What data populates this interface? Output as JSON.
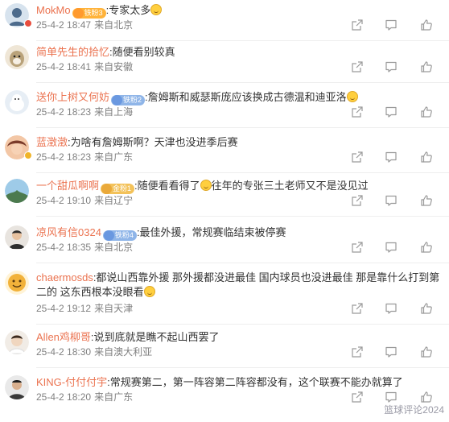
{
  "comments": [
    {
      "id": "c1",
      "username": "MokMo",
      "badge": "铁粉3",
      "badge_style": "orange",
      "text": ":专家太多",
      "emoji_after": true,
      "emoji_mid": false,
      "text2": "",
      "date": "25-4-2 18:47",
      "source": "来自北京",
      "avatar_color": "#4d6b8c",
      "vbadge": "#e84d3d"
    },
    {
      "id": "c2",
      "username": "简单先生的拾忆",
      "badge": "",
      "badge_style": "orange",
      "text": ":随便看别较真",
      "emoji_after": false,
      "emoji_mid": false,
      "text2": "",
      "date": "25-4-2 18:41",
      "source": "来自安徽",
      "avatar_color": "#b9a27a",
      "vbadge": ""
    },
    {
      "id": "c3",
      "username": "送你上树又何妨",
      "badge": "铁粉2",
      "badge_style": "blue",
      "text": ":詹姆斯和威瑟斯庞应该换成古德温和迪亚洛",
      "emoji_after": true,
      "emoji_mid": false,
      "text2": "",
      "date": "25-4-2 18:23",
      "source": "来自上海",
      "avatar_color": "#cfd8e0",
      "vbadge": ""
    },
    {
      "id": "c4",
      "username": "蓝澂澂",
      "badge": "",
      "badge_style": "orange",
      "text": ":为啥有詹姆斯啊？天津也没进季后赛",
      "emoji_after": false,
      "emoji_mid": false,
      "text2": "",
      "date": "25-4-2 18:23",
      "source": "来自广东",
      "avatar_color": "#7a3b2a",
      "vbadge": "#f0b429"
    },
    {
      "id": "c5",
      "username": "一个甜瓜啊啊",
      "badge": "金粉1",
      "badge_style": "gold",
      "text": ":随便看看得了",
      "emoji_after": false,
      "emoji_mid": true,
      "text2": "往年的专张三土老师又不是没见过",
      "date": "25-4-2 19:10",
      "source": "来自辽宁",
      "avatar_color": "#4c7a4e",
      "vbadge": ""
    },
    {
      "id": "c6",
      "username": "凉风有信0324",
      "badge": "铁粉4",
      "badge_style": "blue",
      "text": ":最佳外援，常规赛临结束被停赛",
      "emoji_after": false,
      "emoji_mid": false,
      "text2": "",
      "date": "25-4-2 18:35",
      "source": "来自北京",
      "avatar_color": "#2d2d2d",
      "vbadge": ""
    },
    {
      "id": "c7",
      "username": "chaermosds",
      "badge": "",
      "badge_style": "orange",
      "text": ":都说山西靠外援 那外援都没进最佳 国内球员也没进最佳 那是靠什么打到第二的 这东西根本没眼看",
      "emoji_after": true,
      "emoji_mid": false,
      "text2": "",
      "date": "25-4-2 19:12",
      "source": "来自天津",
      "avatar_color": "#f2b23a",
      "vbadge": ""
    },
    {
      "id": "c8",
      "username": "Allen鸡柳哥",
      "badge": "",
      "badge_style": "orange",
      "text": ":说到底就是瞧不起山西罢了",
      "emoji_after": false,
      "emoji_mid": false,
      "text2": "",
      "date": "25-4-2 18:30",
      "source": "来自澳大利亚",
      "avatar_color": "#c9b8a8",
      "vbadge": ""
    },
    {
      "id": "c9",
      "username": "KING-付付付宇",
      "badge": "",
      "badge_style": "orange",
      "text": ":常规赛第二，第一阵容第二阵容都没有，这个联赛不能办就算了",
      "emoji_after": false,
      "emoji_mid": false,
      "text2": "",
      "date": "25-4-2 18:20",
      "source": "来自广东",
      "avatar_color": "#3a3a3a",
      "vbadge": ""
    }
  ],
  "icons": {
    "share": "share-icon",
    "comment": "comment-icon",
    "like": "thumbs-up-icon"
  },
  "watermark": "篮球评论2024"
}
